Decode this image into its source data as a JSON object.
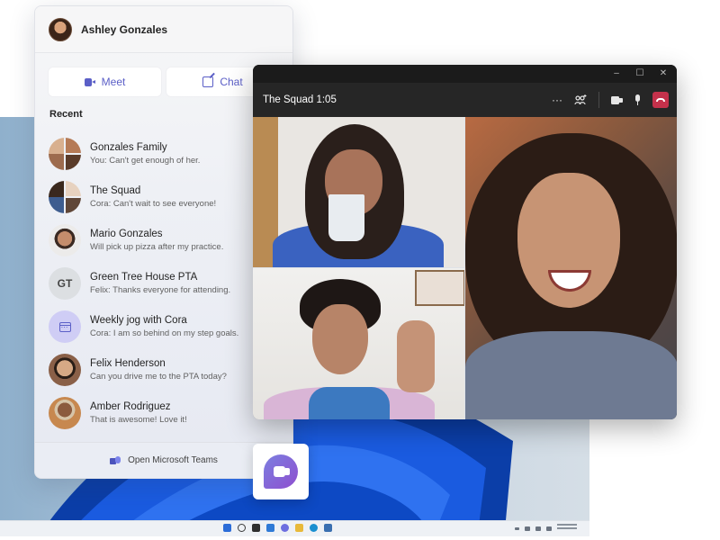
{
  "flyout": {
    "user_name": "Ashley Gonzales",
    "meet_label": "Meet",
    "chat_label": "Chat",
    "recent_title": "Recent",
    "chats": [
      {
        "name": "Gonzales Family",
        "preview": "You: Can't get enough of her.",
        "avatar": "group-photo"
      },
      {
        "name": "The Squad",
        "preview": "Cora: Can't wait to see everyone!",
        "avatar": "group-photo"
      },
      {
        "name": "Mario Gonzales",
        "preview": "Will pick up pizza after my practice.",
        "avatar": "photo"
      },
      {
        "name": "Green Tree House PTA",
        "preview": "Felix: Thanks everyone for attending.",
        "avatar": "initials",
        "initials": "GT"
      },
      {
        "name": "Weekly jog with Cora",
        "preview": "Cora: I am so behind on my step goals.",
        "avatar": "calendar-icon"
      },
      {
        "name": "Felix Henderson",
        "preview": "Can you drive me to the PTA today?",
        "avatar": "photo"
      },
      {
        "name": "Amber Rodriguez",
        "preview": "That is awesome! Love it!",
        "avatar": "photo"
      }
    ],
    "footer_label": "Open Microsoft Teams"
  },
  "call": {
    "title": "The Squad 1:05",
    "window_controls": {
      "minimize": "–",
      "maximize": "☐",
      "close": "✕"
    },
    "controls": {
      "more": "···",
      "participants": "people-add-icon",
      "video": "video-icon",
      "mic": "mic-icon",
      "hangup": "hangup-icon"
    },
    "participants": [
      "woman-drinking-coffee",
      "man-waving",
      "woman-laughing"
    ]
  },
  "colors": {
    "accent": "#5b5fc7",
    "hangup": "#c4314b",
    "call_bg": "#262626"
  },
  "taskbar": {
    "icons": [
      "start",
      "search",
      "task-view",
      "widgets",
      "chat",
      "file-explorer",
      "edge",
      "store"
    ],
    "icon_colors": [
      "#2b6cd8",
      "#3a3a3a",
      "#2f2f2f",
      "#2f7ad6",
      "#6d6ee0",
      "#e8b93a",
      "#1a8fd0",
      "#3a6fb0"
    ]
  }
}
